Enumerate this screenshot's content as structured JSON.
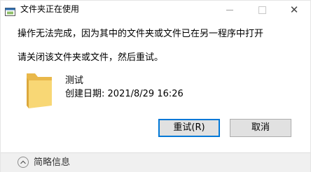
{
  "window": {
    "title": "文件夹正在使用"
  },
  "message": {
    "line1": "操作无法完成，因为其中的文件夹或文件已在另一程序中打开",
    "line2": "请关闭该文件夹或文件，然后重试。"
  },
  "item": {
    "name": "测试",
    "created_label": "创建日期:",
    "created_value": "2021/8/29 16:26",
    "icon": "folder-icon"
  },
  "buttons": {
    "retry": "重试(R)",
    "cancel": "取消"
  },
  "footer": {
    "details": "简略信息"
  },
  "colors": {
    "accent": "#0078d7",
    "folder": "#f8d775",
    "button_bg": "#e1e1e1",
    "footer_bg": "#f0f0f0"
  }
}
